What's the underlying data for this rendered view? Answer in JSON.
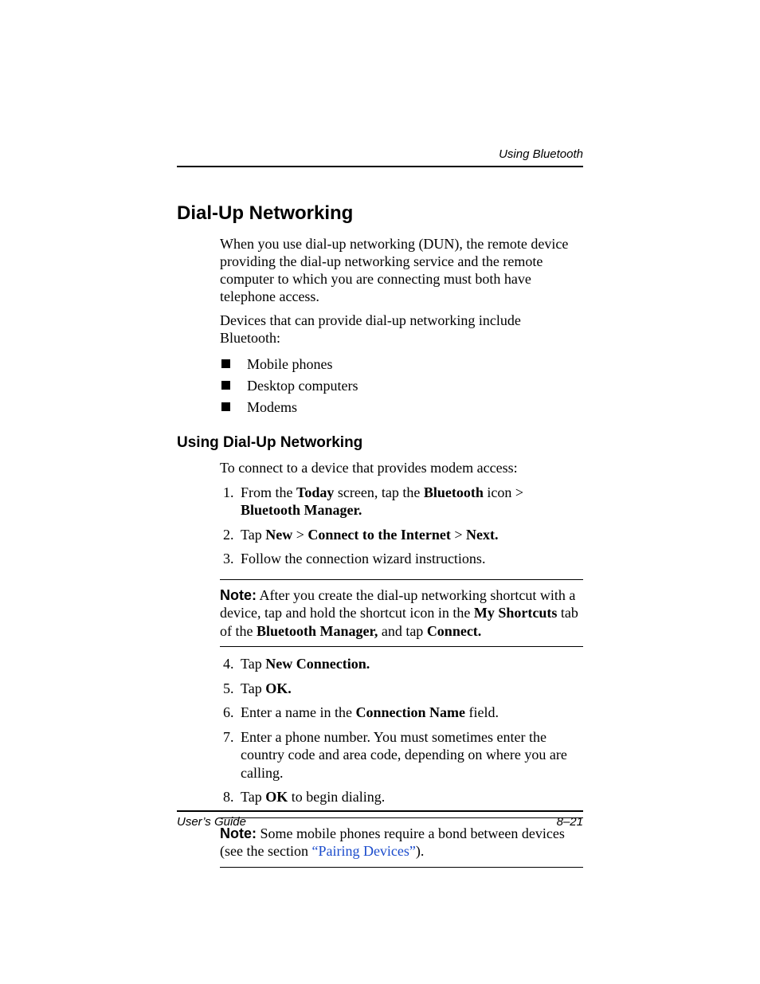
{
  "header": {
    "running": "Using Bluetooth"
  },
  "section": {
    "title": "Dial-Up Networking",
    "intro": "When you use dial-up networking (DUN), the remote device providing the dial-up networking service and the remote computer to which you are connecting must both have telephone access.",
    "devices_lead": "Devices that can provide dial-up networking include Bluetooth:",
    "devices": [
      "Mobile phones",
      "Desktop computers",
      "Modems"
    ]
  },
  "subsection": {
    "title": "Using Dial-Up Networking",
    "lead": "To connect to a device that provides modem access:",
    "step1": {
      "pre": "From the ",
      "b1": "Today",
      "mid1": " screen, tap the ",
      "b2": "Bluetooth",
      "mid2": " icon > ",
      "b3": "Bluetooth Manager."
    },
    "step2": {
      "pre": "Tap ",
      "b1": "New",
      "mid1": " > ",
      "b2": "Connect to the Internet",
      "mid2": " > ",
      "b3": "Next."
    },
    "step3": "Follow the connection wizard instructions.",
    "note1": {
      "label": "Note:",
      "pre": " After you create the dial-up networking shortcut with a device, tap and hold the shortcut icon in the ",
      "b1": "My Shortcuts",
      "mid1": " tab of the ",
      "b2": "Bluetooth Manager,",
      "mid2": " and tap ",
      "b3": "Connect."
    },
    "step4": {
      "pre": "Tap ",
      "b1": "New Connection."
    },
    "step5": {
      "pre": "Tap ",
      "b1": "OK."
    },
    "step6": {
      "pre": "Enter a name in the ",
      "b1": "Connection Name",
      "post": " field."
    },
    "step7": "Enter a phone number. You must sometimes enter the country code and area code, depending on where you are calling.",
    "step8": {
      "pre": "Tap ",
      "b1": "OK",
      "post": " to begin dialing."
    },
    "note2": {
      "label": "Note:",
      "pre": " Some mobile phones require a bond between devices (see the section ",
      "link": "“Pairing Devices”",
      "post": ")."
    }
  },
  "footer": {
    "left": "User’s Guide",
    "right": "8–21"
  }
}
